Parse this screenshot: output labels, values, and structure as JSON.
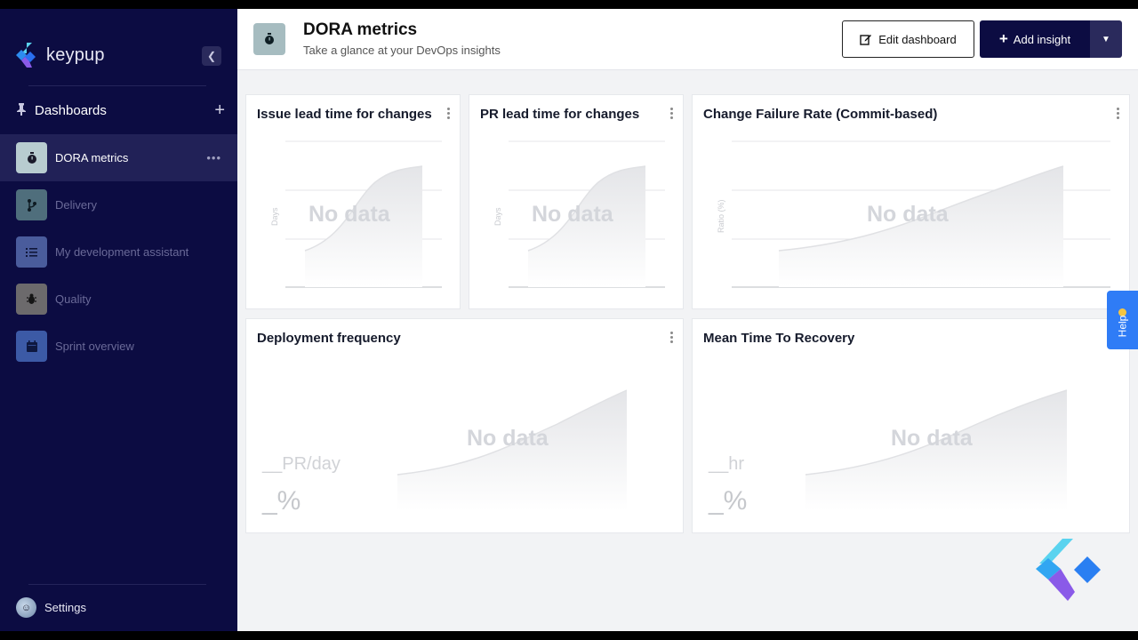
{
  "sidebar": {
    "brand": "keypup",
    "section_title": "Dashboards",
    "items": [
      {
        "label": "DORA metrics",
        "icon": "stopwatch-icon",
        "color": "#b8ccd0",
        "active": true
      },
      {
        "label": "Delivery",
        "icon": "git-branch-icon",
        "color": "#4f6e7c",
        "active": false
      },
      {
        "label": "My development assistant",
        "icon": "task-list-icon",
        "color": "#4a5c9c",
        "active": false
      },
      {
        "label": "Quality",
        "icon": "bug-icon",
        "color": "#6c6a6c",
        "active": false
      },
      {
        "label": "Sprint overview",
        "icon": "calendar-icon",
        "color": "#3c5aa6",
        "active": false
      }
    ],
    "settings_label": "Settings"
  },
  "header": {
    "title": "DORA metrics",
    "subtitle": "Take a glance at your DevOps insights",
    "edit_label": "Edit dashboard",
    "add_label": "Add insight"
  },
  "cards": [
    {
      "title": "Issue lead time for changes",
      "empty_text": "No data",
      "y_label": "Days"
    },
    {
      "title": "PR lead time for changes",
      "empty_text": "No data",
      "y_label": "Days"
    },
    {
      "title": "Change Failure Rate (Commit-based)",
      "empty_text": "No data",
      "y_label": "Ratio (%)"
    },
    {
      "title": "Deployment frequency",
      "empty_text": "No data",
      "value": "__",
      "unit": "PR/day",
      "pct": "_%"
    },
    {
      "title": "Mean Time To Recovery",
      "empty_text": "No data",
      "value": "__",
      "unit": "hr",
      "pct": "_%"
    }
  ],
  "help_label": "Help",
  "colors": {
    "sidebar_bg": "#0c0c42",
    "accent": "#2f7cf6",
    "button_dark": "#0c0c42"
  }
}
